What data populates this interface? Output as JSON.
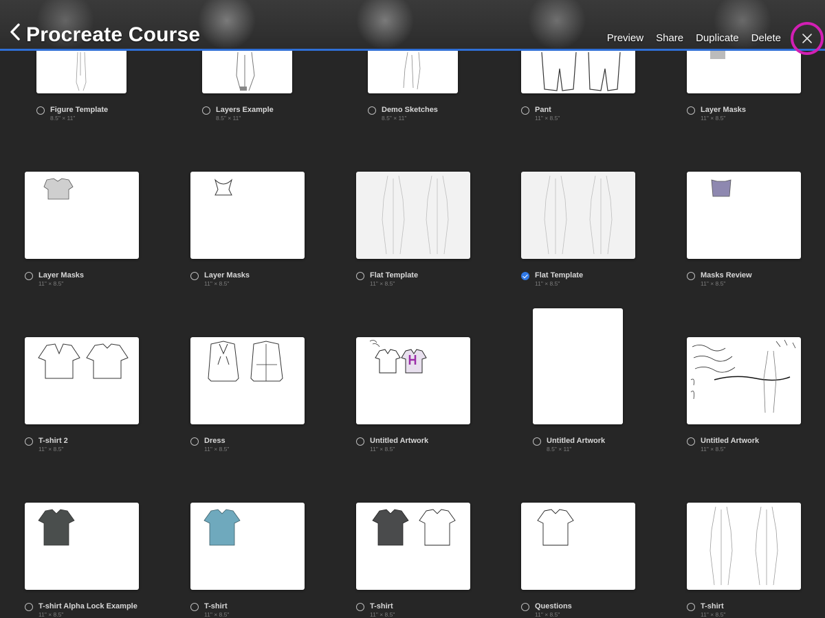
{
  "header": {
    "title": "Procreate Course",
    "actions": [
      "Preview",
      "Share",
      "Duplicate",
      "Delete"
    ],
    "accent_color": "#2f6fd6",
    "close_highlight_color": "#d21fb4",
    "icons": {
      "back": "chevron-left-icon",
      "close": "close-icon"
    }
  },
  "gallery": {
    "rows": [
      [
        {
          "name": "Figure Template",
          "size": "8.5\" × 11\"",
          "selected": false
        },
        {
          "name": "Layers Example",
          "size": "8.5\" × 11\"",
          "selected": false
        },
        {
          "name": "Demo Sketches",
          "size": "8.5\" × 11\"",
          "selected": false
        },
        {
          "name": "Pant",
          "size": "11\" × 8.5\"",
          "selected": false
        },
        {
          "name": "Layer Masks",
          "size": "11\" × 8.5\"",
          "selected": false
        }
      ],
      [
        {
          "name": "Layer Masks",
          "size": "11\" × 8.5\"",
          "selected": false
        },
        {
          "name": "Layer Masks",
          "size": "11\" × 8.5\"",
          "selected": false
        },
        {
          "name": "Flat Template",
          "size": "11\" × 8.5\"",
          "selected": false
        },
        {
          "name": "Flat Template",
          "size": "11\" × 8.5\"",
          "selected": true
        },
        {
          "name": "Masks Review",
          "size": "11\" × 8.5\"",
          "selected": false
        }
      ],
      [
        {
          "name": "T-shirt 2",
          "size": "11\" × 8.5\"",
          "selected": false
        },
        {
          "name": "Dress",
          "size": "11\" × 8.5\"",
          "selected": false
        },
        {
          "name": "Untitled Artwork",
          "size": "11\" × 8.5\"",
          "selected": false
        },
        {
          "name": "Untitled Artwork",
          "size": "8.5\" × 11\"",
          "selected": false
        },
        {
          "name": "Untitled Artwork",
          "size": "11\" × 8.5\"",
          "selected": false
        }
      ],
      [
        {
          "name": "T-shirt Alpha Lock Example",
          "size": "11\" × 8.5\"",
          "selected": false
        },
        {
          "name": "T-shirt",
          "size": "11\" × 8.5\"",
          "selected": false
        },
        {
          "name": "T-shirt",
          "size": "11\" × 8.5\"",
          "selected": false
        },
        {
          "name": "Questions",
          "size": "11\" × 8.5\"",
          "selected": false
        },
        {
          "name": "T-shirt",
          "size": "11\" × 8.5\"",
          "selected": false
        }
      ]
    ]
  }
}
